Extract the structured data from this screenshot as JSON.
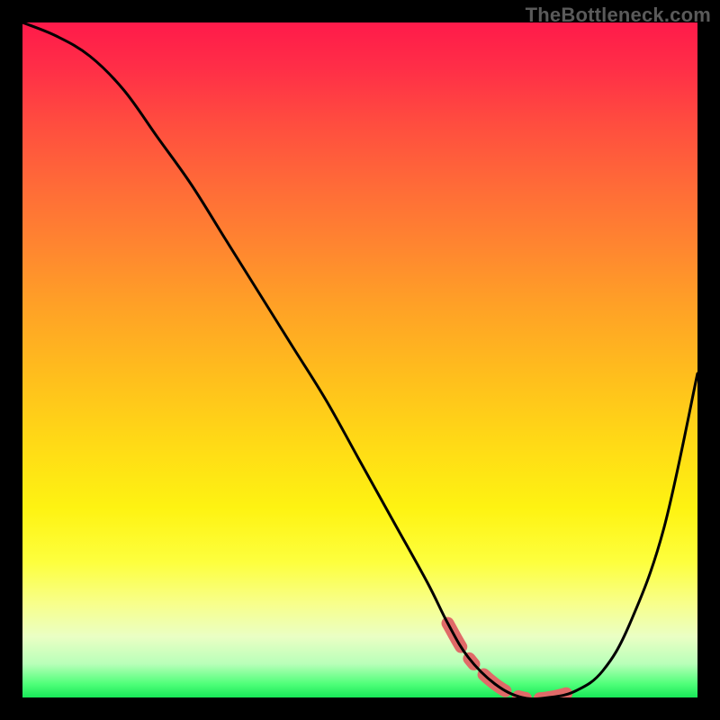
{
  "watermark": "TheBottleneck.com",
  "chart_data": {
    "type": "line",
    "title": "",
    "xlabel": "",
    "ylabel": "",
    "xlim": [
      0,
      100
    ],
    "ylim": [
      0,
      100
    ],
    "x": [
      0,
      5,
      10,
      15,
      20,
      25,
      30,
      35,
      40,
      45,
      50,
      55,
      60,
      63,
      66,
      70,
      74,
      78,
      82,
      86,
      90,
      95,
      100
    ],
    "values": [
      100,
      98,
      95,
      90,
      83,
      76,
      68,
      60,
      52,
      44,
      35,
      26,
      17,
      11,
      6,
      2,
      0,
      0,
      1,
      4,
      11,
      25,
      48
    ],
    "highlight_range_x": [
      63,
      82
    ],
    "gradient_colors": {
      "top": "#ff1a4a",
      "mid_upper": "#ff8530",
      "mid": "#ffd916",
      "mid_lower": "#fdff3e",
      "bottom": "#18e858"
    }
  }
}
